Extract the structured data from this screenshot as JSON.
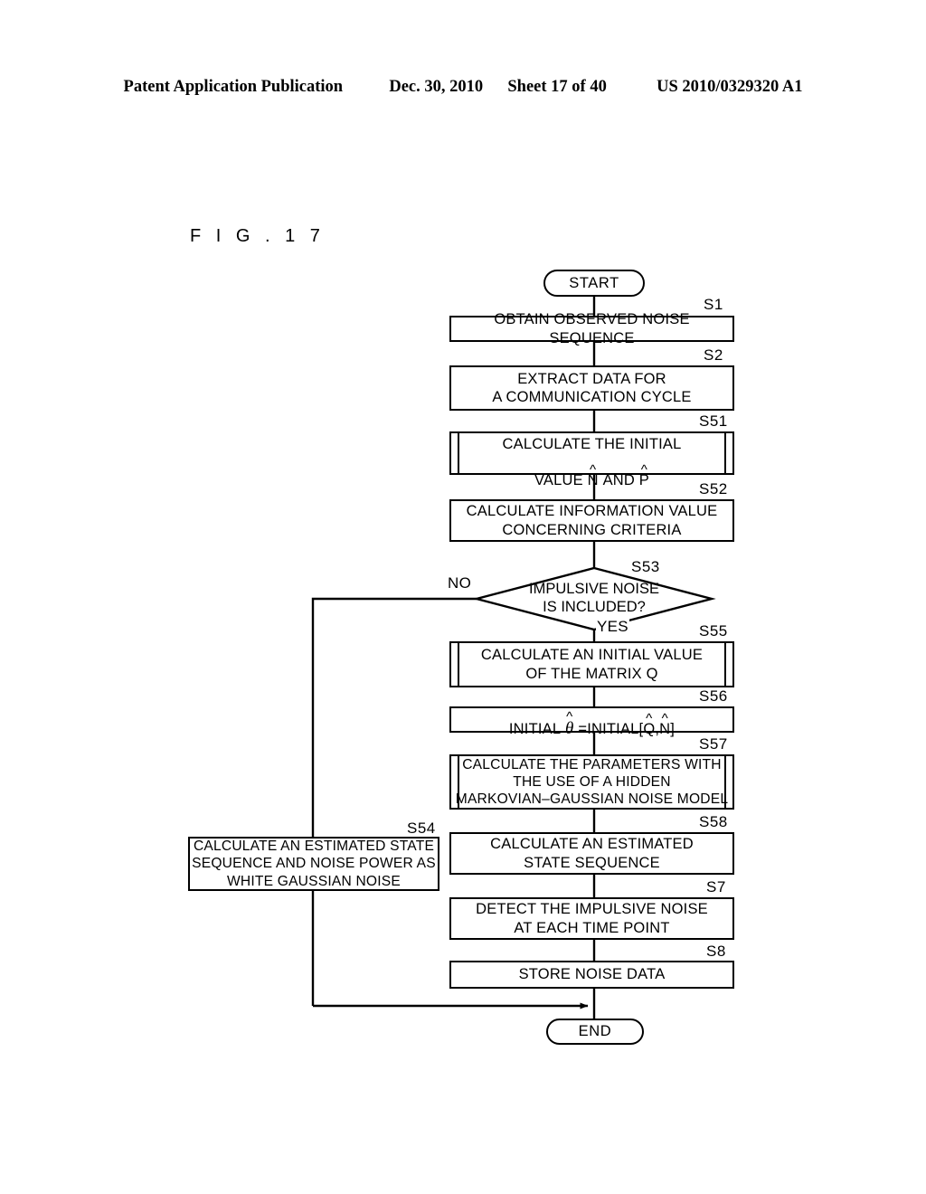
{
  "header": {
    "publication": "Patent Application Publication",
    "date": "Dec. 30, 2010",
    "sheet": "Sheet 17 of 40",
    "patent_number": "US 2010/0329320 A1"
  },
  "figure": {
    "label": "F I G .   1 7"
  },
  "flowchart": {
    "start_label": "START",
    "end_label": "END",
    "yes_label": "YES",
    "no_label": "NO",
    "nodes": [
      {
        "id": "S1",
        "tag": "S1",
        "text": "OBTAIN OBSERVED NOISE SEQUENCE",
        "shape": "process"
      },
      {
        "id": "S2",
        "tag": "S2",
        "text": "EXTRACT DATA FOR\nA COMMUNICATION CYCLE",
        "shape": "process"
      },
      {
        "id": "S51",
        "tag": "S51",
        "text": "CALCULATE THE INITIAL\nVALUE N AND P",
        "shape": "predefined-process"
      },
      {
        "id": "S52",
        "tag": "S52",
        "text": "CALCULATE INFORMATION VALUE\nCONCERNING CRITERIA",
        "shape": "process"
      },
      {
        "id": "S53",
        "tag": "S53",
        "text": "IMPULSIVE NOISE\nIS INCLUDED?",
        "shape": "decision"
      },
      {
        "id": "S55",
        "tag": "S55",
        "text": "CALCULATE AN INITIAL VALUE\nOF THE MATRIX Q",
        "shape": "predefined-process"
      },
      {
        "id": "S56",
        "tag": "S56",
        "text": "INITIAL θ =INITIAL[Q,N]",
        "shape": "process"
      },
      {
        "id": "S57",
        "tag": "S57",
        "text": "CALCULATE THE PARAMETERS WITH\nTHE USE OF A HIDDEN\nMARKOVIAN–GAUSSIAN NOISE MODEL",
        "shape": "predefined-process"
      },
      {
        "id": "S54",
        "tag": "S54",
        "text": "CALCULATE AN ESTIMATED STATE\nSEQUENCE AND NOISE POWER AS\nWHITE GAUSSIAN NOISE",
        "shape": "process"
      },
      {
        "id": "S58",
        "tag": "S58",
        "text": "CALCULATE AN ESTIMATED\nSTATE SEQUENCE",
        "shape": "process"
      },
      {
        "id": "S7",
        "tag": "S7",
        "text": "DETECT THE IMPULSIVE NOISE\nAT EACH TIME POINT",
        "shape": "process"
      },
      {
        "id": "S8",
        "tag": "S8",
        "text": "STORE NOISE DATA",
        "shape": "process"
      }
    ],
    "formula_s51": {
      "prefix": "CALCULATE THE INITIAL",
      "line2_a": "VALUE",
      "sym1": "N",
      "line2_b": "AND",
      "sym2": "P"
    },
    "formula_s56": {
      "a": "INITIAL",
      "theta": "θ",
      "eq": "=INITIAL[",
      "q": "Q",
      "comma": ",",
      "n": "N",
      "close": "]"
    }
  }
}
